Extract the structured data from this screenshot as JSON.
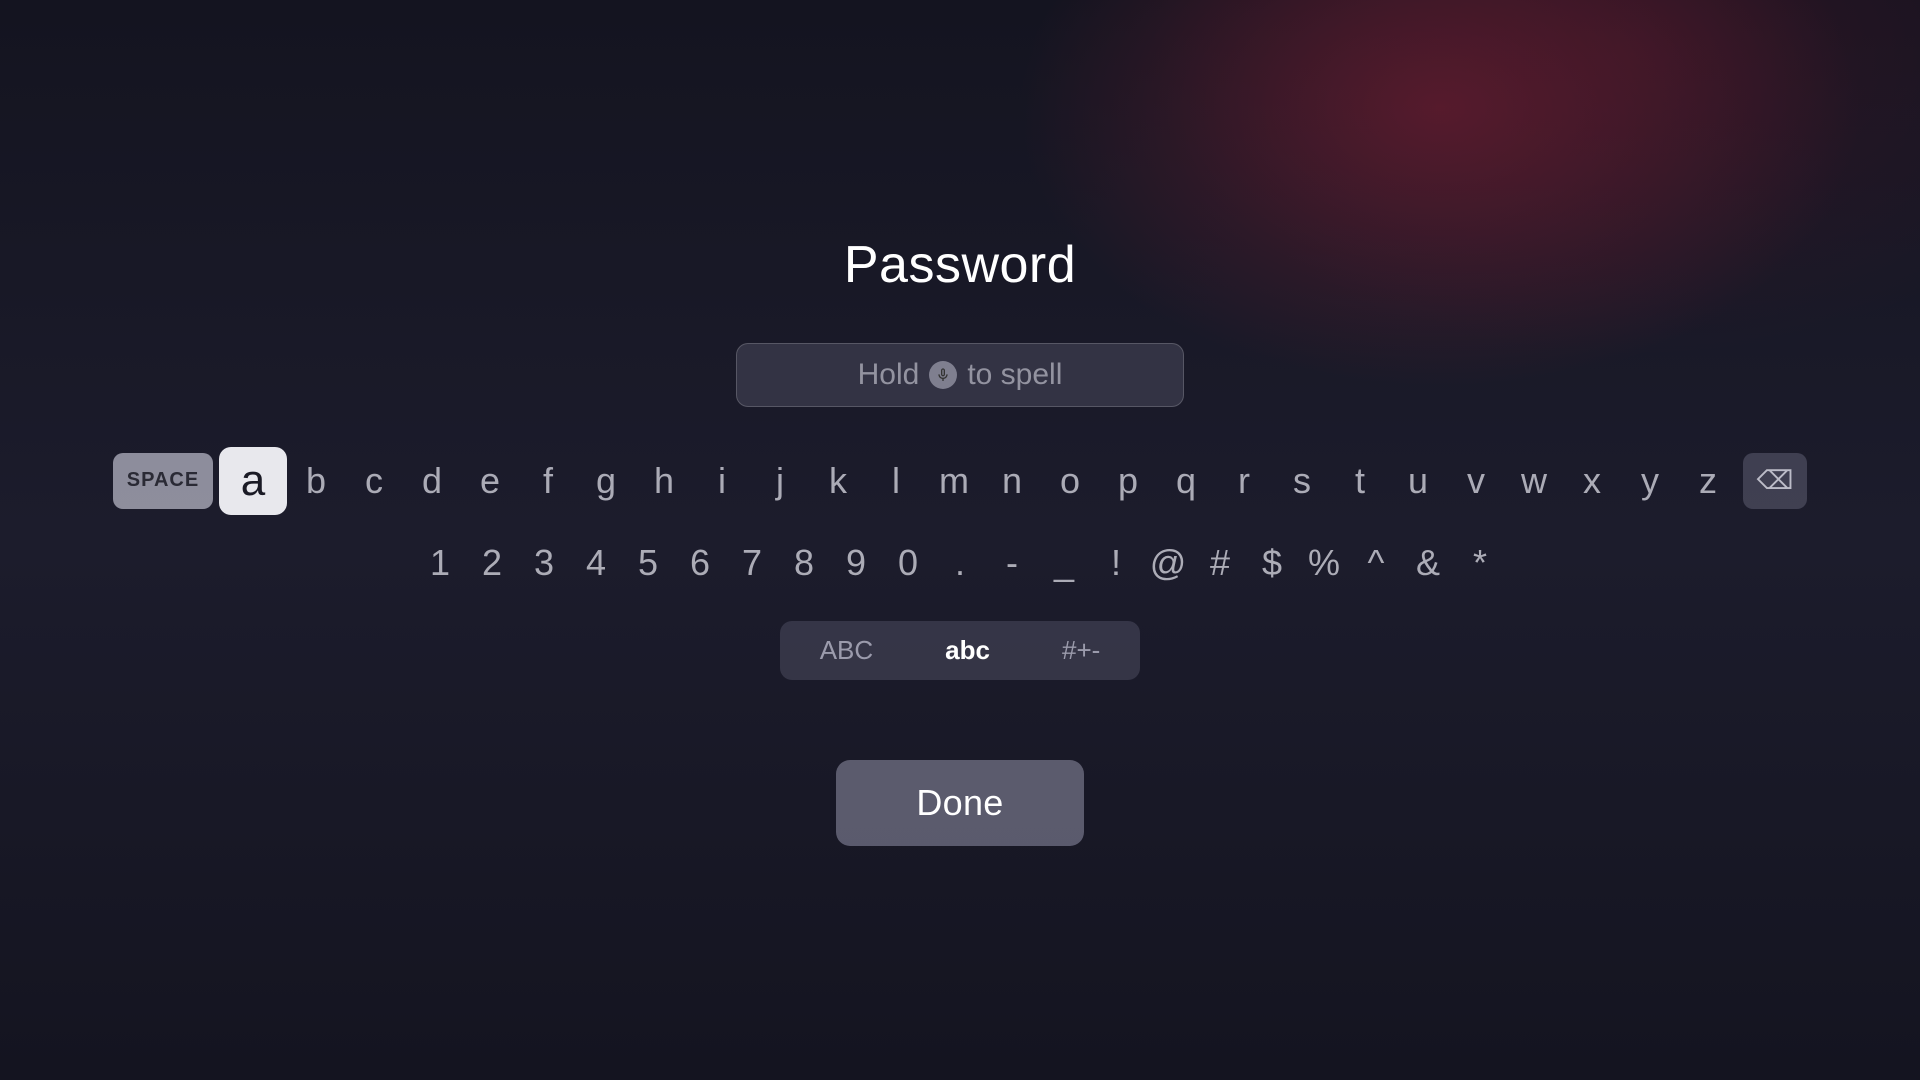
{
  "title": "Password",
  "input": {
    "placeholder_before": "Hold",
    "placeholder_after": "to spell"
  },
  "keyboard": {
    "space_label": "SPACE",
    "letters": [
      "a",
      "b",
      "c",
      "d",
      "e",
      "f",
      "g",
      "h",
      "i",
      "j",
      "k",
      "l",
      "m",
      "n",
      "o",
      "p",
      "q",
      "r",
      "s",
      "t",
      "u",
      "v",
      "w",
      "x",
      "y",
      "z"
    ],
    "numbers": [
      "1",
      "2",
      "3",
      "4",
      "5",
      "6",
      "7",
      "8",
      "9",
      "0"
    ],
    "symbols": [
      ".",
      "-",
      "_",
      "!",
      "@",
      "#",
      "$",
      "%",
      "^",
      "&",
      "*"
    ],
    "selected_letter": "a",
    "delete_icon": "⌫"
  },
  "modes": [
    {
      "label": "ABC",
      "active": false
    },
    {
      "label": "abc",
      "active": true
    },
    {
      "label": "#+-",
      "active": false
    }
  ],
  "done_button": "Done",
  "colors": {
    "background": "#1a1a2e",
    "accent_glow": "#7a1e32",
    "key_default": "rgba(220,220,230,0.75)",
    "key_selected_bg": "#e8e8ed",
    "done_bg": "rgba(120,120,140,0.7)"
  }
}
